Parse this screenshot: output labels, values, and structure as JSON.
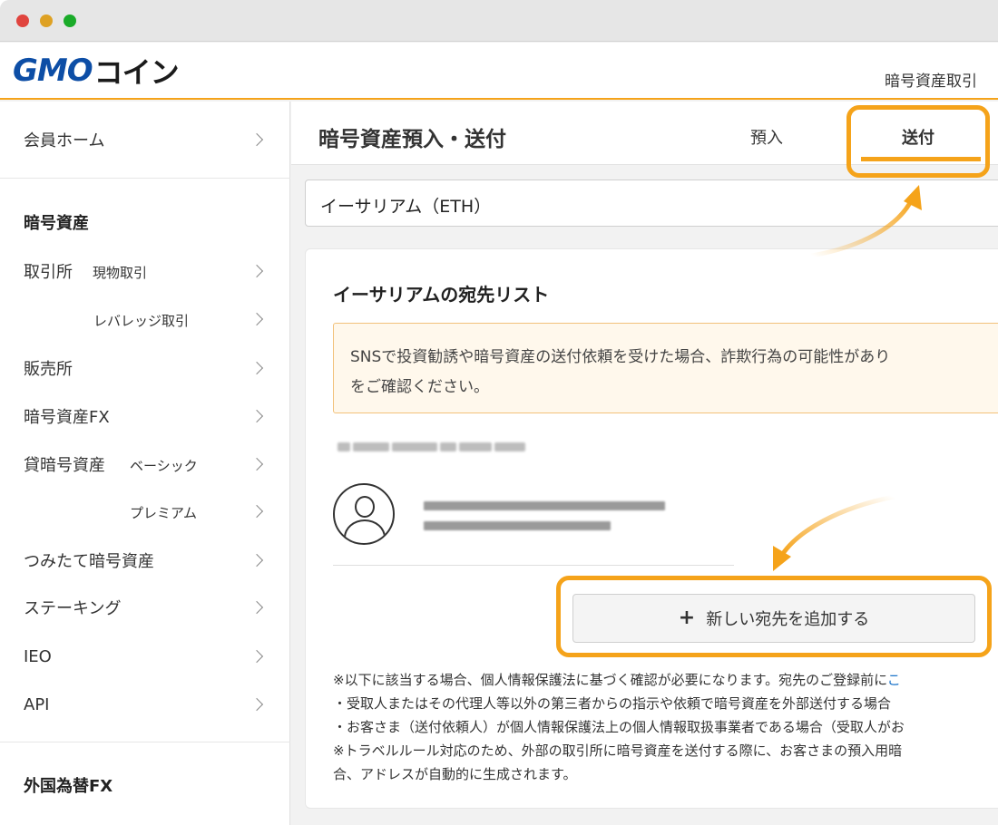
{
  "window": {
    "traffic_lights": [
      "close",
      "minimize",
      "zoom"
    ]
  },
  "header": {
    "logo_gmo": "GMO",
    "logo_coin": "コイン",
    "right_text": "暗号資産取引"
  },
  "sidebar": {
    "home": "会員ホーム",
    "section_crypto": "暗号資産",
    "exchange": "取引所",
    "spot": "現物取引",
    "leverage": "レバレッジ取引",
    "sales": "販売所",
    "crypto_fx": "暗号資産FX",
    "lending": "貸暗号資産",
    "lending_basic": "ベーシック",
    "lending_premium": "プレミアム",
    "tsumitate": "つみたて暗号資産",
    "staking": "ステーキング",
    "ieo": "IEO",
    "api": "API",
    "section_fx": "外国為替FX"
  },
  "main": {
    "title": "暗号資産預入・送付",
    "tabs": [
      {
        "label": "預入",
        "active": false
      },
      {
        "label": "送付",
        "active": true
      }
    ],
    "select_value": "イーサリアム（ETH）",
    "card": {
      "title": "イーサリアムの宛先リスト",
      "warning_line1": "SNSで投資勧誘や暗号資産の送付依頼を受けた場合、詐欺行為の可能性があり",
      "warning_line2": "をご確認ください。",
      "add_button_icon": "plus-icon",
      "add_button_label": "新しい宛先を追加する",
      "notes": [
        "※以下に該当する場合、個人情報保護法に基づく確認が必要になります。宛先のご登録前に",
        "・受取人またはその代理人等以外の第三者からの指示や依頼で暗号資産を外部送付する場合",
        "・お客さま（送付依頼人）が個人情報保護法上の個人情報取扱事業者である場合（受取人がお",
        "※トラベルルール対応のため、外部の取引所に暗号資産を送付する際に、お客さまの預入用暗",
        "合、アドレスが自動的に生成されます。"
      ],
      "note_link": "こ"
    }
  },
  "colors": {
    "accent_orange": "#f5a31a",
    "logo_blue": "#0d4ea6",
    "link_blue": "#1a73c9"
  }
}
